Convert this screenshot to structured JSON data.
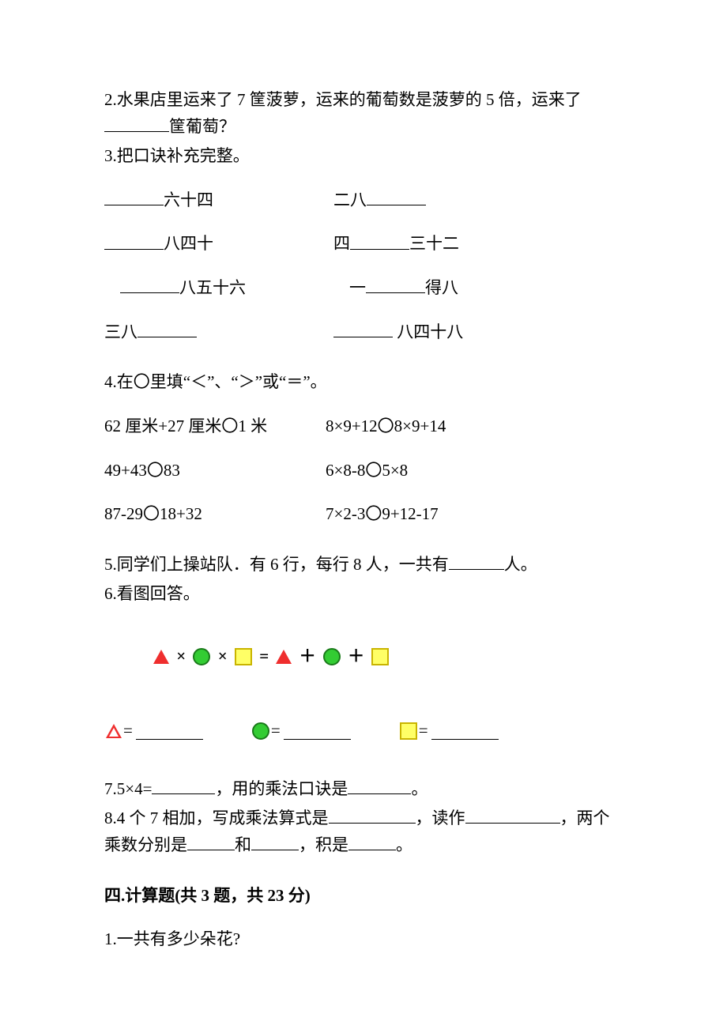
{
  "q2": {
    "prefix": "2.水果店里运来了 7 筐菠萝，运来的葡萄数是菠萝的 5 倍，运来了",
    "suffix": "筐葡萄？"
  },
  "q3": {
    "title": "3.把口诀补充完整。",
    "rows": [
      {
        "left_after": "六十四",
        "right_before": "二八"
      },
      {
        "left_after": "八四十",
        "right_before": "四",
        "right_after": "三十二"
      },
      {
        "left_after": "八五十六",
        "indent": true,
        "right_before": "一",
        "right_after": "得八"
      },
      {
        "left_before": "三八",
        "right_after": " 八四十八"
      }
    ]
  },
  "q4": {
    "title": "4.在〇里填“＜”、“＞”或“＝”。",
    "rows": [
      {
        "l": "62 厘米+27 厘米〇1 米",
        "r": "8×9+12〇8×9+14"
      },
      {
        "l": "49+43〇83",
        "r": "6×8-8〇5×8"
      },
      {
        "l": "87-29〇18+32",
        "r": "7×2-3〇9+12-17"
      }
    ]
  },
  "q5": {
    "prefix": "5.同学们上操站队．有 6 行，每行 8 人，一共有",
    "suffix": "人。"
  },
  "q6": {
    "title": "6.看图回答。",
    "eq_ops": [
      "×",
      "×",
      "=",
      "＋",
      "＋"
    ],
    "eq_label": "="
  },
  "q7": {
    "p1": "7.5×4=",
    "p2": "，用的乘法口诀是",
    "p3": "。"
  },
  "q8": {
    "p1": "8.4 个 7 相加，写成乘法算式是",
    "p2": "，读作",
    "p3": "，两个乘数分别是",
    "p4": "和",
    "p5": "，积是",
    "p6": "。"
  },
  "section4": {
    "title": "四.计算题(共 3 题，共 23 分)"
  },
  "s4q1": {
    "text": "1.一共有多少朵花?"
  }
}
